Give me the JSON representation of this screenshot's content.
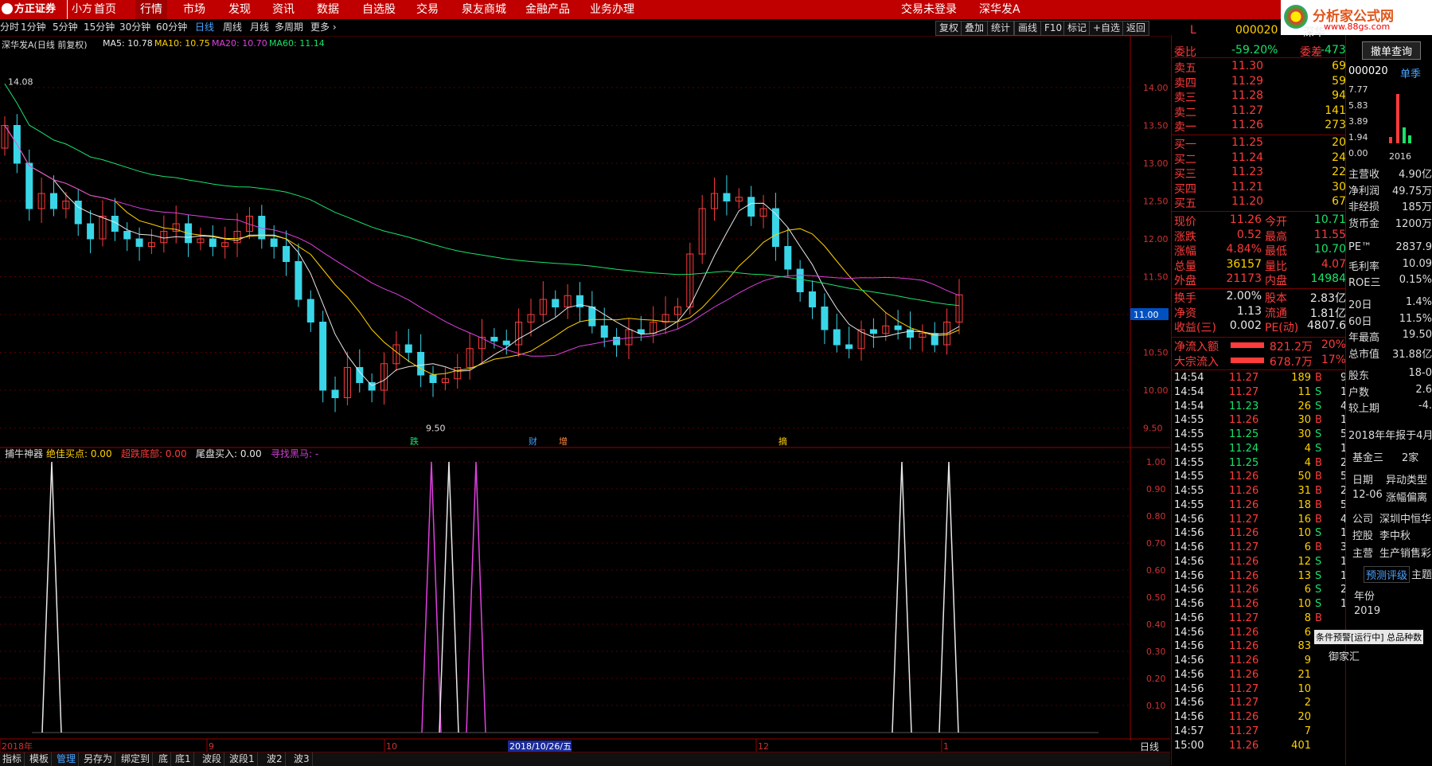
{
  "menubar": {
    "logo_text": "方正证券",
    "logo_sub": "小方",
    "items": [
      "首页",
      "行情",
      "市场",
      "发现",
      "资讯",
      "数据",
      "自选股",
      "交易",
      "泉友商城",
      "金融产品",
      "业务办理"
    ],
    "status_text": "交易未登录",
    "stock_name": "深华发A",
    "brand": "分析家公式网",
    "brand_url": "www.88gs.com"
  },
  "toolbar": {
    "periods": [
      "分时",
      "1分钟",
      "5分钟",
      "15分钟",
      "30分钟",
      "60分钟",
      "日线",
      "周线",
      "月线",
      "多周期",
      "更多"
    ],
    "active_period": "日线",
    "right_buttons": [
      "复权",
      "叠加",
      "统计",
      "画线",
      "F10",
      "标记",
      "+自选",
      "返回"
    ]
  },
  "chart_header": {
    "title": "深华发A(日线 前复权)",
    "ma5": "MA5: 10.78",
    "ma10": "MA10: 10.75",
    "ma20": "MA20: 10.70",
    "ma60": "MA60: 11.14",
    "high_label": "14.08",
    "low_label": "9.50",
    "current_price_tag": "11.00"
  },
  "price_axis": [
    "14.00",
    "13.50",
    "13.00",
    "12.50",
    "12.00",
    "11.50",
    "11.00",
    "10.50",
    "10.00",
    "9.50"
  ],
  "event_markers": [
    "跌",
    "财",
    "增",
    "摘"
  ],
  "indicator": {
    "name": "捕牛神器",
    "items": [
      {
        "label": "绝佳买点: 0.00",
        "color": "#ffd200"
      },
      {
        "label": "超跌底部: 0.00",
        "color": "#ff3b3b"
      },
      {
        "label": "尾盘买入: 0.00",
        "color": "#e8e8e8"
      },
      {
        "label": "寻找黑马: -",
        "color": "#d040d0"
      }
    ],
    "axis": [
      "1.00",
      "0.90",
      "0.80",
      "0.70",
      "0.60",
      "0.50",
      "0.40",
      "0.30",
      "0.20",
      "0.10"
    ]
  },
  "date_axis": {
    "labels": [
      "2018年",
      "9",
      "10",
      "12",
      "1"
    ],
    "cursor_date": "2018/10/26/五"
  },
  "bottom_tabs": [
    "指标",
    "模板",
    "管理",
    "另存为",
    "绑定到",
    "底",
    "底1",
    "波段",
    "波段1",
    "波2",
    "波3"
  ],
  "bottom_right": "日线",
  "quote": {
    "code_line_l": "L",
    "code": "000020",
    "name_short": "深华",
    "weibi_label": "委比",
    "weibi_value": "-59.20%",
    "weicha_label": "委差",
    "weicha_value": "-473",
    "asks": [
      {
        "label": "卖五",
        "price": "11.30",
        "vol": "69"
      },
      {
        "label": "卖四",
        "price": "11.29",
        "vol": "59"
      },
      {
        "label": "卖三",
        "price": "11.28",
        "vol": "94"
      },
      {
        "label": "卖二",
        "price": "11.27",
        "vol": "141"
      },
      {
        "label": "卖一",
        "price": "11.26",
        "vol": "273"
      }
    ],
    "bids": [
      {
        "label": "买一",
        "price": "11.25",
        "vol": "20"
      },
      {
        "label": "买二",
        "price": "11.24",
        "vol": "24"
      },
      {
        "label": "买三",
        "price": "11.23",
        "vol": "22"
      },
      {
        "label": "买四",
        "price": "11.21",
        "vol": "30"
      },
      {
        "label": "买五",
        "price": "11.20",
        "vol": "67"
      }
    ],
    "stats": [
      {
        "l1": "现价",
        "v1": "11.26",
        "c1": "red",
        "l2": "今开",
        "v2": "10.71",
        "c2": "green"
      },
      {
        "l1": "涨跌",
        "v1": "0.52",
        "c1": "red",
        "l2": "最高",
        "v2": "11.55",
        "c2": "red"
      },
      {
        "l1": "涨幅",
        "v1": "4.84%",
        "c1": "red",
        "l2": "最低",
        "v2": "10.70",
        "c2": "green"
      },
      {
        "l1": "总量",
        "v1": "36157",
        "c1": "yellow",
        "l2": "量比",
        "v2": "4.07",
        "c2": "red"
      },
      {
        "l1": "外盘",
        "v1": "21173",
        "c1": "red",
        "l2": "内盘",
        "v2": "14984",
        "c2": "green"
      }
    ],
    "stats2": [
      {
        "l1": "换手",
        "v1": "2.00%",
        "l2": "股本",
        "v2": "2.83亿"
      },
      {
        "l1": "净资",
        "v1": "1.13",
        "l2": "流通",
        "v2": "1.81亿"
      },
      {
        "l1": "收益(三)",
        "v1": "0.002",
        "l2": "PE(动)",
        "v2": "4807.6"
      }
    ],
    "flows": [
      {
        "label": "净流入额",
        "value": "821.2万",
        "pct": "20%"
      },
      {
        "label": "大宗流入",
        "value": "678.7万",
        "pct": "17%"
      }
    ],
    "ticks": [
      [
        "14:54",
        "11.27",
        "189",
        "B",
        "9"
      ],
      [
        "14:54",
        "11.27",
        "11",
        "S",
        "1"
      ],
      [
        "14:54",
        "11.23",
        "26",
        "S",
        "4"
      ],
      [
        "14:55",
        "11.26",
        "30",
        "B",
        "1"
      ],
      [
        "14:55",
        "11.25",
        "30",
        "S",
        "5"
      ],
      [
        "14:55",
        "11.24",
        "4",
        "S",
        "1"
      ],
      [
        "14:55",
        "11.25",
        "4",
        "B",
        "2"
      ],
      [
        "14:55",
        "11.26",
        "50",
        "B",
        "5"
      ],
      [
        "14:55",
        "11.26",
        "31",
        "B",
        "2"
      ],
      [
        "14:55",
        "11.26",
        "18",
        "B",
        "5"
      ],
      [
        "14:56",
        "11.27",
        "16",
        "B",
        "4"
      ],
      [
        "14:56",
        "11.26",
        "10",
        "S",
        "1"
      ],
      [
        "14:56",
        "11.27",
        "6",
        "B",
        "3"
      ],
      [
        "14:56",
        "11.26",
        "12",
        "S",
        "1"
      ],
      [
        "14:56",
        "11.26",
        "13",
        "S",
        "1"
      ],
      [
        "14:56",
        "11.26",
        "6",
        "S",
        "2"
      ],
      [
        "14:56",
        "11.26",
        "10",
        "S",
        "1"
      ],
      [
        "14:56",
        "11.27",
        "8",
        "B",
        ""
      ],
      [
        "14:56",
        "11.26",
        "6",
        "",
        ""
      ],
      [
        "14:56",
        "11.26",
        "83",
        "",
        ""
      ],
      [
        "14:56",
        "11.26",
        "9",
        "",
        ""
      ],
      [
        "14:56",
        "11.26",
        "21",
        "",
        ""
      ],
      [
        "14:56",
        "11.27",
        "10",
        "",
        ""
      ],
      [
        "14:56",
        "11.27",
        "2",
        "",
        ""
      ],
      [
        "14:56",
        "11.26",
        "20",
        "",
        ""
      ],
      [
        "14:57",
        "11.27",
        "7",
        "",
        ""
      ],
      [
        "15:00",
        "11.26",
        "401",
        "",
        ""
      ]
    ]
  },
  "f10": {
    "button": "撤单查询",
    "code": "000020",
    "season": "单季",
    "mini_axis": [
      "7.77",
      "5.83",
      "3.89",
      "1.94",
      "0.00"
    ],
    "mini_year": "2016",
    "rows": [
      {
        "k": "主营收",
        "v": "4.90亿"
      },
      {
        "k": "净利润",
        "v": "49.75万"
      },
      {
        "k": "非经损",
        "v": "185万"
      },
      {
        "k": "货币金",
        "v": "1200万"
      },
      {
        "k": "PE™",
        "v": "2837.9"
      },
      {
        "k": "毛利率",
        "v": "10.09"
      },
      {
        "k": "ROE三",
        "v": "0.15%"
      },
      {
        "k": "20日",
        "v": "1.4%"
      },
      {
        "k": "60日",
        "v": "11.5%"
      },
      {
        "k": "年最高",
        "v": "19.50"
      },
      {
        "k": "总市值",
        "v": "31.88亿"
      },
      {
        "k": "股东",
        "v": "18-0"
      },
      {
        "k": "户数",
        "v": "2.6"
      },
      {
        "k": "较上期",
        "v": "-4."
      }
    ],
    "report_note": "2018年年报于4月",
    "fund": "基金三",
    "fund_v": "2家",
    "date_k": "日期",
    "date_v": "异动类型",
    "event_date": "12-06",
    "event_type": "涨幅偏离",
    "company_k": "公司",
    "company_v": "深圳中恒华",
    "holder_k": "控股",
    "holder_v": "李中秋",
    "business_k": "主营",
    "business_v": "生产销售彩",
    "rating_tab": "预测评级",
    "rating_tab2": "主题",
    "year_k": "年份",
    "year_v": "2019",
    "alert_text": "条件预警[运行中] 总品种数",
    "alert_sub": "御家汇"
  }
}
